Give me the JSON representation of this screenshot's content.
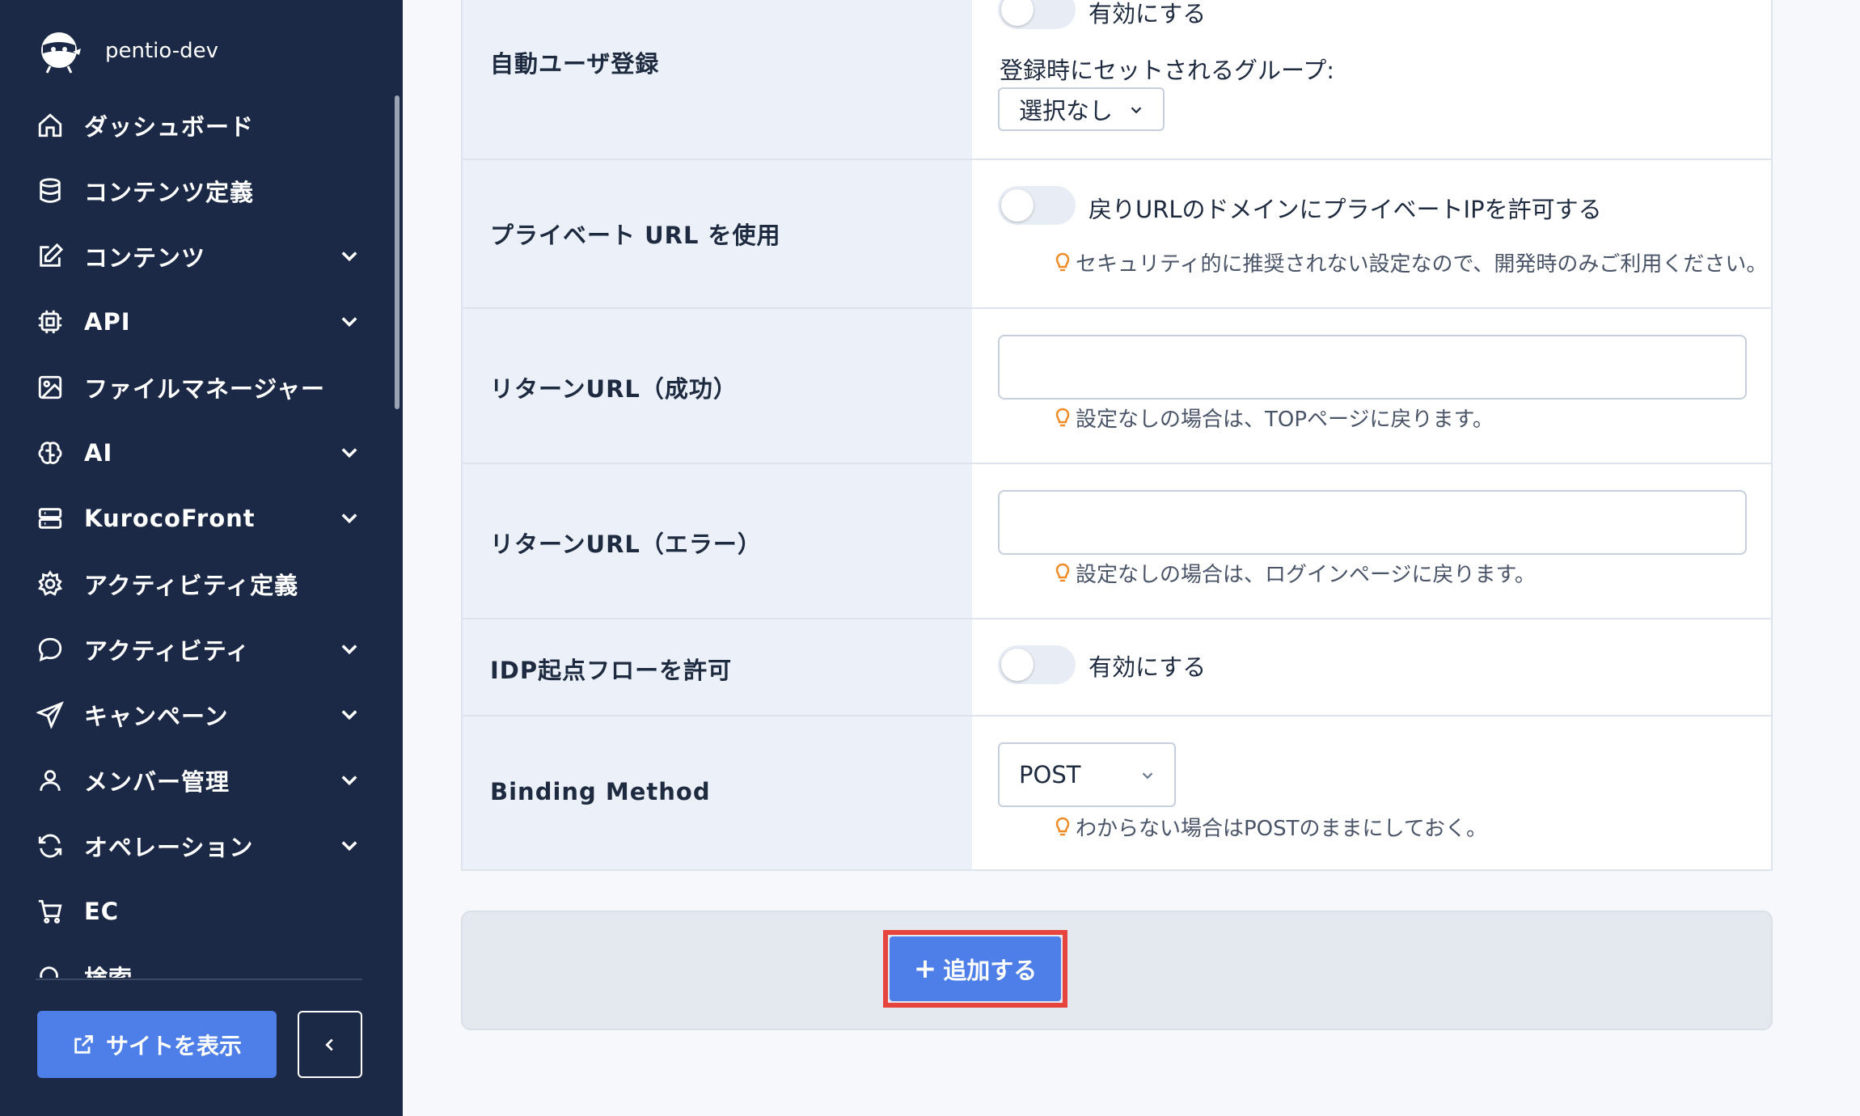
{
  "sidebar": {
    "site_name": "pentio-dev",
    "items": [
      {
        "label": "ダッシュボード",
        "icon": "home-icon",
        "has_children": false
      },
      {
        "label": "コンテンツ定義",
        "icon": "database-icon",
        "has_children": false
      },
      {
        "label": "コンテンツ",
        "icon": "edit-icon",
        "has_children": true
      },
      {
        "label": "API",
        "icon": "chip-icon",
        "has_children": true
      },
      {
        "label": "ファイルマネージャー",
        "icon": "image-icon",
        "has_children": false
      },
      {
        "label": "AI",
        "icon": "brain-icon",
        "has_children": true
      },
      {
        "label": "KurocoFront",
        "icon": "server-icon",
        "has_children": true
      },
      {
        "label": "アクティビティ定義",
        "icon": "gear-icon",
        "has_children": false
      },
      {
        "label": "アクティビティ",
        "icon": "chat-icon",
        "has_children": true
      },
      {
        "label": "キャンペーン",
        "icon": "send-icon",
        "has_children": true
      },
      {
        "label": "メンバー管理",
        "icon": "user-icon",
        "has_children": true
      },
      {
        "label": "オペレーション",
        "icon": "refresh-icon",
        "has_children": true
      },
      {
        "label": "EC",
        "icon": "cart-icon",
        "has_children": false
      },
      {
        "label": "検索",
        "icon": "search-icon",
        "has_children": false
      }
    ],
    "view_site_label": "サイトを表示"
  },
  "form": {
    "auto_register": {
      "label": "自動ユーザ登録",
      "toggle_text": "有効にする",
      "group_label": "登録時にセットされるグループ:",
      "group_value": "選択なし"
    },
    "private_url": {
      "label": "プライベート URL を使用",
      "toggle_text": "戻りURLのドメインにプライベートIPを許可する",
      "hint": "セキュリティ的に推奨されない設定なので、開発時のみご利用ください。"
    },
    "return_success": {
      "label": "リターンURL（成功）",
      "value": "",
      "hint": "設定なしの場合は、TOPページに戻ります。"
    },
    "return_error": {
      "label": "リターンURL（エラー）",
      "value": "",
      "hint": "設定なしの場合は、ログインページに戻ります。"
    },
    "idp_flow": {
      "label": "IDP起点フローを許可",
      "toggle_text": "有効にする"
    },
    "binding_method": {
      "label": "Binding Method",
      "value": "POST",
      "hint": "わからない場合はPOSTのままにしておく。"
    }
  },
  "actions": {
    "add_label": "追加する"
  },
  "colors": {
    "sidebar_bg": "#1b2946",
    "accent": "#4e7fe8",
    "highlight": "#e5453e",
    "hint_icon": "#f08a24"
  }
}
